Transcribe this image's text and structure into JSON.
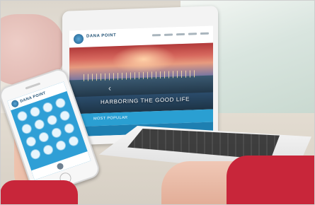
{
  "laptop": {
    "brand": "DANA POINT",
    "tagline": "HARBORING THE GOOD LIFE",
    "section_label": "MOST POPULAR"
  },
  "phone": {
    "brand": "DANA POINT",
    "icon_count": 16
  }
}
